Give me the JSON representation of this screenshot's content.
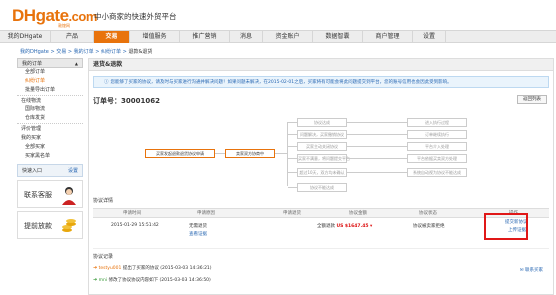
{
  "header": {
    "logo_dh": "DH",
    "logo_gate": "gate",
    "logo_com": ".com",
    "logo_sub": "敦煌网",
    "slogan": "中小商家的快速外贸平台"
  },
  "nav": {
    "items": [
      {
        "label": "我的DHgate"
      },
      {
        "label": "产品"
      },
      {
        "label": "交易"
      },
      {
        "label": "增值服务"
      },
      {
        "label": "推广营销"
      },
      {
        "label": "消息"
      },
      {
        "label": "资金账户"
      },
      {
        "label": "数据智囊"
      },
      {
        "label": "商户管理"
      },
      {
        "label": "设置"
      }
    ],
    "active_index": 2
  },
  "breadcrumb": {
    "items": [
      "我的DHgate",
      "交易",
      "我的订单",
      "纠纷订单"
    ],
    "current": "退款&退货",
    "sep": " > "
  },
  "sidebar": {
    "head1": "我的订单",
    "toggle": "▲",
    "orders": [
      "全部订单",
      "纠纷订单",
      "批量导出订单"
    ],
    "group2": "在线物流",
    "logistics": [
      "国际物流",
      "仓库发货"
    ],
    "group3": "评价管理",
    "group4": "我的买家",
    "buyers": [
      "全部买家",
      "买家黑名单"
    ],
    "box_label": "快速入口",
    "box_link": "设置",
    "contact1": "联系客服",
    "contact2": "提前放款"
  },
  "main": {
    "title": "退货&退款",
    "notice": "您能够了买家的协议，请及时与买家进行沟通并解决问题！如果问题未解决，在2015-02-01之后，买家将有可能会将此问题提交到平台，您的账号信用也会因此受到影响。",
    "order_label": "订单号：",
    "order_no": "30001062",
    "back_label": "返回列表",
    "flow": {
      "start": "买家发起退款退货协议申请",
      "seller": "卖家双方协商中",
      "branches": [
        "协议达成",
        "问题解决，买家撤销协议",
        "买家主动关闭协议",
        "买家不满意，将问题提交平台",
        "超过10天，双方均未确认",
        "协议不能达成"
      ],
      "results": [
        "进入执行过程",
        "订单继续执行",
        "平台介入处理",
        "平台依据买卖双方处理",
        "系统自动视为协议不能达成"
      ]
    },
    "detail_title": "协议详情",
    "columns": [
      "申请时间",
      "申请原因",
      "申请退货",
      "协议金额",
      "协议状态",
      "操作"
    ],
    "row": {
      "time": "2015-01-29 15:51:42",
      "reason": "无需退货",
      "evidence_link": "查看证据",
      "amount_prefix": "全额退款",
      "amount": "US $1647.45",
      "amount_unit": "▾",
      "status": "协议被卖家拒绝",
      "op1": "提交新协议",
      "op2": "上传证据"
    },
    "log_title": "协议记录",
    "logs": [
      {
        "who": "testyu001",
        "text": " 提出了买家的协议 (2015-03-03 14:36:21)"
      },
      {
        "who": "mni",
        "text": " 修改了协议协议内容如下 (2015-03-03 14:36:50)"
      }
    ],
    "contact_buyer": "联系买家"
  },
  "colors": {
    "accent": "#e8730c",
    "link": "#2867b2",
    "alert_red": "#e01818"
  }
}
